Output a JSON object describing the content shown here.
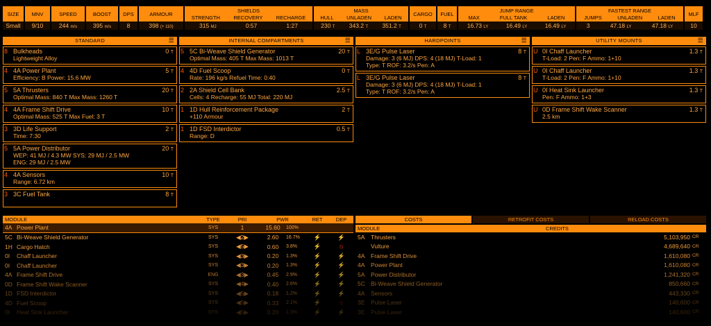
{
  "stats": {
    "cols": [
      {
        "key": "size",
        "head": "SIZE",
        "val": "Small"
      },
      {
        "key": "mnv",
        "head": "MNV",
        "val": "9/10"
      },
      {
        "key": "speed",
        "head": "SPEED",
        "val": "244",
        "unit": "m/s"
      },
      {
        "key": "boost",
        "head": "BOOST",
        "val": "395",
        "unit": "m/s"
      },
      {
        "key": "dps",
        "head": "DPS",
        "val": "8"
      },
      {
        "key": "armour",
        "head": "ARMOUR",
        "val": "398",
        "unit": "(+ 110)"
      }
    ],
    "shields": {
      "head": "SHIELDS",
      "sub": [
        "STRENGTH",
        "RECOVERY",
        "RECHARGE"
      ],
      "vals": [
        "315",
        "0:57",
        "1:27"
      ],
      "units": [
        "MJ",
        "",
        ""
      ]
    },
    "mass": {
      "head": "MASS",
      "sub": [
        "HULL",
        "UNLADEN",
        "LADEN"
      ],
      "vals": [
        "230",
        "343.2",
        "351.2"
      ],
      "units": [
        "T",
        "T",
        "T"
      ]
    },
    "cargo": {
      "head": "CARGO",
      "val": "0",
      "unit": "T"
    },
    "fuel": {
      "head": "FUEL",
      "val": "8",
      "unit": "T"
    },
    "jump": {
      "head": "JUMP RANGE",
      "sub": [
        "MAX",
        "FULL TANK",
        "LADEN"
      ],
      "vals": [
        "16.73",
        "16.49",
        "16.49"
      ],
      "units": [
        "LY",
        "LY",
        "LY"
      ]
    },
    "fastest": {
      "head": "FASTEST RANGE",
      "sub": [
        "JUMPS",
        "UNLADEN",
        "LADEN"
      ],
      "vals": [
        "3",
        "47.18",
        "47.18"
      ],
      "units": [
        "",
        "LY",
        "LY"
      ]
    },
    "mlf": {
      "head": "MLF",
      "val": "10"
    }
  },
  "standard": {
    "title": "STANDARD",
    "slots": [
      {
        "cls": "8",
        "name": "Bulkheads",
        "detail": "Lightweight Alloy",
        "mass": "0",
        "unit": "T"
      },
      {
        "cls": "4",
        "name": "4A Power Plant",
        "detail": "Efficiency: B  Power: 15.6 MW",
        "mass": "5",
        "unit": "T"
      },
      {
        "cls": "5",
        "name": "5A Thrusters",
        "detail": "Optimal Mass: 840 T  Max Mass: 1260 T",
        "mass": "20",
        "unit": "T"
      },
      {
        "cls": "4",
        "name": "4A Frame Shift Drive",
        "detail": "Optimal Mass: 525 T  Max Fuel: 3 T",
        "mass": "10",
        "unit": "T"
      },
      {
        "cls": "3",
        "name": "3D Life Support",
        "detail": "Time: 7:30",
        "mass": "2",
        "unit": "T"
      },
      {
        "cls": "5",
        "name": "5A Power Distributor",
        "detail": "WEP: 41 MJ / 4.3 MW  SYS: 29 MJ / 2.5 MW",
        "detail2": "ENG: 29 MJ / 2.5 MW",
        "mass": "20",
        "unit": "T"
      },
      {
        "cls": "4",
        "name": "4A Sensors",
        "detail": "Range: 6.72 km",
        "mass": "10",
        "unit": "T"
      },
      {
        "cls": "3",
        "name": "3C Fuel Tank",
        "detail": "",
        "mass": "8",
        "unit": "T"
      }
    ]
  },
  "internal": {
    "title": "INTERNAL COMPARTMENTS",
    "slots": [
      {
        "cls": "5",
        "name": "5C Bi-Weave Shield Generator",
        "detail": "Optimal Mass: 405 T  Max Mass: 1013 T",
        "mass": "20",
        "unit": "T"
      },
      {
        "cls": "4",
        "name": "4D Fuel Scoop",
        "detail": "Rate: 196 kg/s  Refuel Time: 0:40",
        "mass": "0",
        "unit": "T"
      },
      {
        "cls": "2",
        "name": "2A Shield Cell Bank",
        "detail": "Cells: 4  Recharge: 55 MJ  Total: 220 MJ",
        "mass": "2.5",
        "unit": "T"
      },
      {
        "cls": "1",
        "name": "1D Hull Reinforcement Package",
        "detail": "+110 Armour",
        "mass": "2",
        "unit": "T"
      },
      {
        "cls": "1",
        "name": "1D FSD Interdictor",
        "detail": "Range: D",
        "mass": "0.5",
        "unit": "T"
      }
    ]
  },
  "hardpoints": {
    "title": "HARDPOINTS",
    "slots": [
      {
        "cls": "L",
        "name": "3E/G Pulse Laser",
        "detail": "Damage: 3 (6 MJ)  DPS: 4 (18 MJ)  T-Load: 1",
        "detail2": "Type: T  ROF: 3.2/s  Pen: A",
        "mass": "8",
        "unit": "T"
      },
      {
        "cls": "L",
        "name": "3E/G Pulse Laser",
        "detail": "Damage: 3 (6 MJ)  DPS: 4 (18 MJ)  T-Load: 1",
        "detail2": "Type: T  ROF: 3.2/s  Pen: A",
        "mass": "8",
        "unit": "T"
      }
    ]
  },
  "utility": {
    "title": "UTILITY MOUNTS",
    "slots": [
      {
        "cls": "U",
        "name": "0I Chaff Launcher",
        "detail": "T-Load: 2  Pen: F  Ammo: 1+10",
        "mass": "1.3",
        "unit": "T"
      },
      {
        "cls": "U",
        "name": "0I Chaff Launcher",
        "detail": "T-Load: 2  Pen: F  Ammo: 1+10",
        "mass": "1.3",
        "unit": "T"
      },
      {
        "cls": "U",
        "name": "0I Heat Sink Launcher",
        "detail": "Pen: F  Ammo: 1+3",
        "mass": "1.3",
        "unit": "T"
      },
      {
        "cls": "U",
        "name": "0D Frame Shift Wake Scanner",
        "detail": "2.5 km",
        "mass": "1.3",
        "unit": "T"
      }
    ]
  },
  "power": {
    "headers": [
      "MODULE",
      "TYPE",
      "PRI",
      "PWR",
      "RET",
      "DEP"
    ],
    "selected": {
      "cls": "4A",
      "name": "Power Plant",
      "type": "SYS",
      "pri": "1",
      "pwr": "15.60",
      "pct": "100%"
    },
    "rows": [
      {
        "cls": "5C",
        "name": "Bi-Weave Shield Generator",
        "type": "SYS",
        "pri": "2",
        "pwr": "2.60",
        "pct": "16.7%",
        "ret": "bolt",
        "dep": "bolt"
      },
      {
        "cls": "1H",
        "name": "Cargo Hatch",
        "type": "SYS",
        "pri": "5",
        "pwr": "0.60",
        "pct": "3.8%",
        "ret": "bolt",
        "dep": "ban"
      },
      {
        "cls": "0I",
        "name": "Chaff Launcher",
        "type": "SYS",
        "pri": "3",
        "pwr": "0.20",
        "pct": "1.3%",
        "ret": "bolt",
        "dep": "bolt"
      },
      {
        "cls": "0I",
        "name": "Chaff Launcher",
        "type": "SYS",
        "pri": "3",
        "pwr": "0.20",
        "pct": "1.3%",
        "ret": "bolt",
        "dep": "bolt"
      },
      {
        "cls": "4A",
        "name": "Frame Shift Drive",
        "type": "ENG",
        "pri": "3",
        "pwr": "0.45",
        "pct": "2.9%",
        "ret": "bolt",
        "dep": "bolt"
      },
      {
        "cls": "0D",
        "name": "Frame Shift Wake Scanner",
        "type": "SYS",
        "pri": "4",
        "pwr": "0.40",
        "pct": "2.6%",
        "ret": "bolt",
        "dep": "bolt"
      },
      {
        "cls": "1D",
        "name": "FSD Interdictor",
        "type": "SYS",
        "pri": "5",
        "pwr": "0.18",
        "pct": "1.2%",
        "ret": "bolt",
        "dep": "bolt"
      },
      {
        "cls": "4D",
        "name": "Fuel Scoop",
        "type": "SYS",
        "pri": "5",
        "pwr": "0.33",
        "pct": "2.1%",
        "ret": "bolt",
        "dep": "ban"
      },
      {
        "cls": "0I",
        "name": "Heat Sink Launcher",
        "type": "SYS",
        "pri": "5",
        "pwr": "0.20",
        "pct": "1.3%",
        "ret": "bolt",
        "dep": "bolt"
      }
    ]
  },
  "costs": {
    "tabs": [
      "COSTS",
      "RETROFIT COSTS",
      "RELOAD COSTS"
    ],
    "headers": [
      "MODULE",
      "CREDITS"
    ],
    "rows": [
      {
        "cls": "5A",
        "name": "Thrusters",
        "credits": "5,103,950",
        "unit": "CR"
      },
      {
        "cls": "",
        "name": "Vulture",
        "credits": "4,689,640",
        "unit": "CR"
      },
      {
        "cls": "4A",
        "name": "Frame Shift Drive",
        "credits": "1,610,080",
        "unit": "CR"
      },
      {
        "cls": "4A",
        "name": "Power Plant",
        "credits": "1,610,080",
        "unit": "CR"
      },
      {
        "cls": "5A",
        "name": "Power Distributor",
        "credits": "1,241,320",
        "unit": "CR"
      },
      {
        "cls": "5C",
        "name": "Bi-Weave Shield Generator",
        "credits": "850,660",
        "unit": "CR"
      },
      {
        "cls": "4A",
        "name": "Sensors",
        "credits": "443,330",
        "unit": "CR"
      },
      {
        "cls": "3E",
        "name": "Pulse Laser",
        "credits": "140,600",
        "unit": "CR"
      },
      {
        "cls": "3E",
        "name": "Pulse Laser",
        "credits": "140,600",
        "unit": "CR"
      }
    ]
  },
  "colors": {
    "accent": "#ff8c0d",
    "bg": "#000000",
    "panel": "#1a0c00",
    "ret": "#3aa0ff",
    "dep_off": "#ff3020"
  }
}
